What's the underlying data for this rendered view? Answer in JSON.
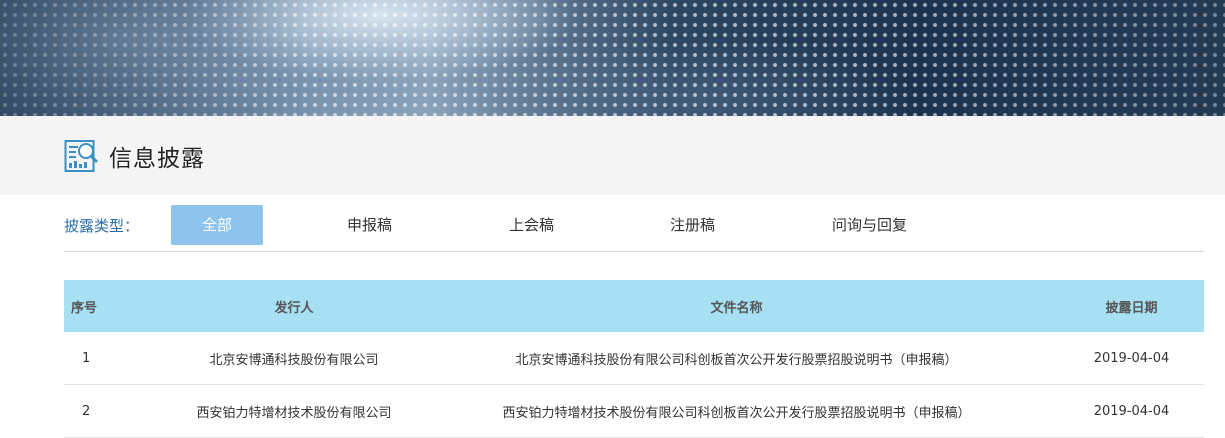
{
  "section": {
    "title": "信息披露"
  },
  "filter": {
    "label": "披露类型：",
    "tabs": [
      {
        "label": "全部",
        "active": true
      },
      {
        "label": "申报稿",
        "active": false
      },
      {
        "label": "上会稿",
        "active": false
      },
      {
        "label": "注册稿",
        "active": false
      },
      {
        "label": "问询与回复",
        "active": false
      }
    ]
  },
  "table": {
    "headers": [
      "序号",
      "发行人",
      "文件名称",
      "披露日期"
    ],
    "rows": [
      {
        "no": "1",
        "issuer": "北京安博通科技股份有限公司",
        "document": "北京安博通科技股份有限公司科创板首次公开发行股票招股说明书（申报稿）",
        "date": "2019-04-04"
      },
      {
        "no": "2",
        "issuer": "西安铂力特增材技术股份有限公司",
        "document": "西安铂力特增材技术股份有限公司科创板首次公开发行股票招股说明书（申报稿）",
        "date": "2019-04-04"
      }
    ]
  },
  "colors": {
    "accent": "#8ec3ec",
    "header_bg": "#a7dff3",
    "label_blue": "#2a6ea8"
  }
}
